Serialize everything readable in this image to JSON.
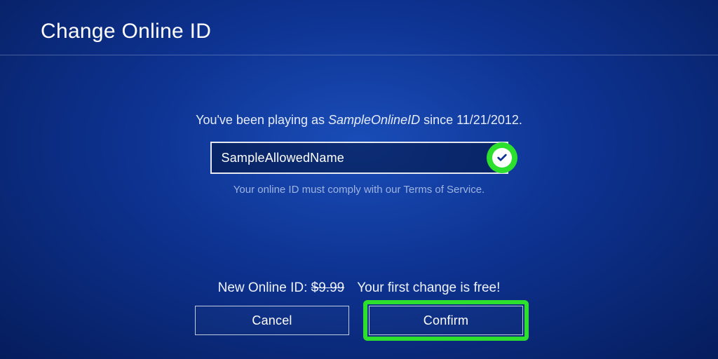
{
  "header": {
    "title": "Change Online ID"
  },
  "main": {
    "playing_prefix": "You've been playing as ",
    "current_id": "SampleOnlineID",
    "playing_middle": " since ",
    "since_date": "11/21/2012",
    "playing_suffix": ".",
    "input_value": "SampleAllowedName",
    "tos_text": "Your online ID must comply with our Terms of Service."
  },
  "footer": {
    "price_label": "New Online ID: ",
    "price_struck": "$9.99",
    "free_msg": "Your first change is free!",
    "cancel_label": "Cancel",
    "confirm_label": "Confirm"
  },
  "colors": {
    "highlight": "#2de02d"
  }
}
